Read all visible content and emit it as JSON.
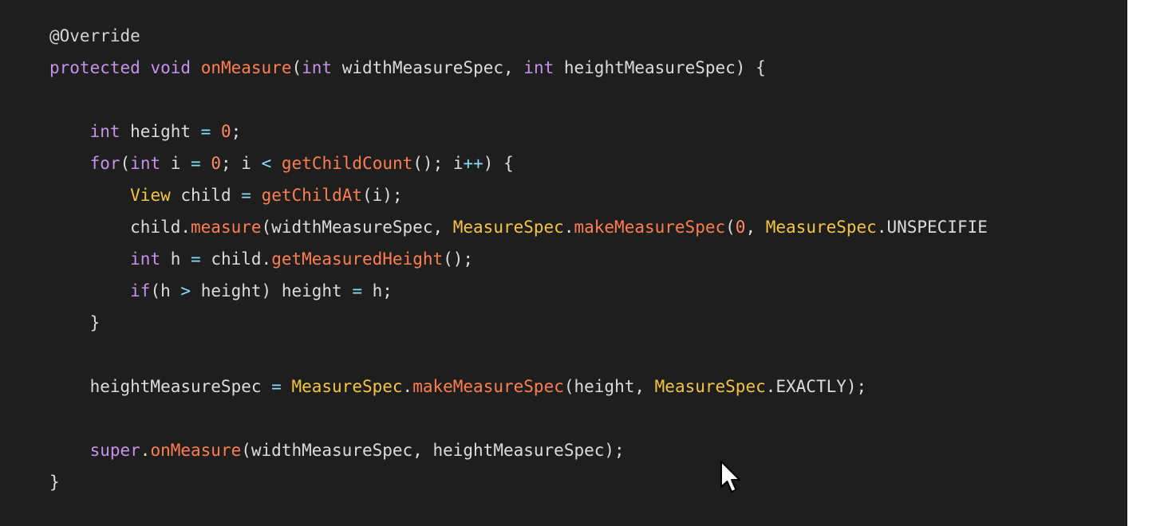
{
  "colors": {
    "background": "#1e1e1e",
    "default_text": "#dcdcdc",
    "keyword": "#c792ea",
    "method": "#ff7f50",
    "class_name": "#f5c542",
    "number": "#ff8a65",
    "operator": "#89ddff"
  },
  "icons": {
    "cursor": "mouse-pointer-icon"
  },
  "code": {
    "lines": [
      [
        {
          "t": "ann",
          "v": "@Override"
        }
      ],
      [
        {
          "t": "kw",
          "v": "protected"
        },
        {
          "t": "txt",
          "v": " "
        },
        {
          "t": "kw",
          "v": "void"
        },
        {
          "t": "txt",
          "v": " "
        },
        {
          "t": "fn",
          "v": "onMeasure"
        },
        {
          "t": "txt",
          "v": "("
        },
        {
          "t": "kw",
          "v": "int"
        },
        {
          "t": "txt",
          "v": " widthMeasureSpec, "
        },
        {
          "t": "kw",
          "v": "int"
        },
        {
          "t": "txt",
          "v": " heightMeasureSpec) {"
        }
      ],
      [],
      [
        {
          "t": "txt",
          "v": "    "
        },
        {
          "t": "kw",
          "v": "int"
        },
        {
          "t": "txt",
          "v": " height "
        },
        {
          "t": "op",
          "v": "="
        },
        {
          "t": "txt",
          "v": " "
        },
        {
          "t": "num",
          "v": "0"
        },
        {
          "t": "txt",
          "v": ";"
        }
      ],
      [
        {
          "t": "txt",
          "v": "    "
        },
        {
          "t": "kw",
          "v": "for"
        },
        {
          "t": "txt",
          "v": "("
        },
        {
          "t": "kw",
          "v": "int"
        },
        {
          "t": "txt",
          "v": " i "
        },
        {
          "t": "op",
          "v": "="
        },
        {
          "t": "txt",
          "v": " "
        },
        {
          "t": "num",
          "v": "0"
        },
        {
          "t": "txt",
          "v": "; i "
        },
        {
          "t": "op",
          "v": "<"
        },
        {
          "t": "txt",
          "v": " "
        },
        {
          "t": "fn",
          "v": "getChildCount"
        },
        {
          "t": "txt",
          "v": "(); i"
        },
        {
          "t": "op",
          "v": "++"
        },
        {
          "t": "txt",
          "v": ") {"
        }
      ],
      [
        {
          "t": "txt",
          "v": "        "
        },
        {
          "t": "cls",
          "v": "View"
        },
        {
          "t": "txt",
          "v": " child "
        },
        {
          "t": "op",
          "v": "="
        },
        {
          "t": "txt",
          "v": " "
        },
        {
          "t": "fn",
          "v": "getChildAt"
        },
        {
          "t": "txt",
          "v": "(i);"
        }
      ],
      [
        {
          "t": "txt",
          "v": "        child."
        },
        {
          "t": "fn",
          "v": "measure"
        },
        {
          "t": "txt",
          "v": "(widthMeasureSpec, "
        },
        {
          "t": "cls",
          "v": "MeasureSpec"
        },
        {
          "t": "txt",
          "v": "."
        },
        {
          "t": "fn",
          "v": "makeMeasureSpec"
        },
        {
          "t": "txt",
          "v": "("
        },
        {
          "t": "num",
          "v": "0"
        },
        {
          "t": "txt",
          "v": ", "
        },
        {
          "t": "cls",
          "v": "MeasureSpec"
        },
        {
          "t": "txt",
          "v": ".UNSPECIFIE"
        }
      ],
      [
        {
          "t": "txt",
          "v": "        "
        },
        {
          "t": "kw",
          "v": "int"
        },
        {
          "t": "txt",
          "v": " h "
        },
        {
          "t": "op",
          "v": "="
        },
        {
          "t": "txt",
          "v": " child."
        },
        {
          "t": "fn",
          "v": "getMeasuredHeight"
        },
        {
          "t": "txt",
          "v": "();"
        }
      ],
      [
        {
          "t": "txt",
          "v": "        "
        },
        {
          "t": "kw",
          "v": "if"
        },
        {
          "t": "txt",
          "v": "(h "
        },
        {
          "t": "op",
          "v": ">"
        },
        {
          "t": "txt",
          "v": " height) height "
        },
        {
          "t": "op",
          "v": "="
        },
        {
          "t": "txt",
          "v": " h;"
        }
      ],
      [
        {
          "t": "txt",
          "v": "    }"
        }
      ],
      [],
      [
        {
          "t": "txt",
          "v": "    heightMeasureSpec "
        },
        {
          "t": "op",
          "v": "="
        },
        {
          "t": "txt",
          "v": " "
        },
        {
          "t": "cls",
          "v": "MeasureSpec"
        },
        {
          "t": "txt",
          "v": "."
        },
        {
          "t": "fn",
          "v": "makeMeasureSpec"
        },
        {
          "t": "txt",
          "v": "(height, "
        },
        {
          "t": "cls",
          "v": "MeasureSpec"
        },
        {
          "t": "txt",
          "v": ".EXACTLY);"
        }
      ],
      [],
      [
        {
          "t": "txt",
          "v": "    "
        },
        {
          "t": "kw",
          "v": "super"
        },
        {
          "t": "txt",
          "v": "."
        },
        {
          "t": "fn",
          "v": "onMeasure"
        },
        {
          "t": "txt",
          "v": "(widthMeasureSpec, heightMeasureSpec);"
        }
      ],
      [
        {
          "t": "txt",
          "v": "}"
        }
      ]
    ]
  }
}
